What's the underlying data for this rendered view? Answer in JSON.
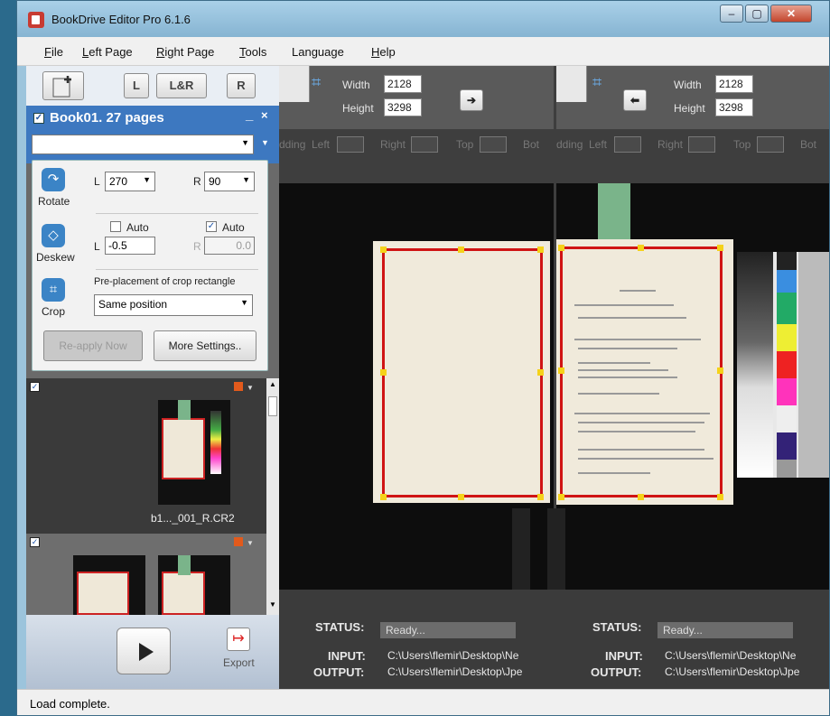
{
  "window": {
    "title": "BookDrive Editor Pro 6.1.6"
  },
  "menu": [
    "File",
    "Left Page",
    "Right Page",
    "Tools",
    "Language",
    "Help"
  ],
  "menu_underline": [
    "F",
    "L",
    "R",
    "T",
    "",
    "H"
  ],
  "toolbar": {
    "l": "L",
    "lr": "L&R",
    "r": "R"
  },
  "book": {
    "header": "Book01. 27 pages",
    "min": "_",
    "close": "×"
  },
  "rotate": {
    "label": "Rotate",
    "l_label": "L",
    "l_value": "270",
    "r_label": "R",
    "r_value": "90"
  },
  "deskew": {
    "label": "Deskew",
    "auto_left": "Auto",
    "auto_right": "Auto",
    "l_label": "L",
    "l_value": "-0.5",
    "r_label": "R",
    "r_value": "0.0"
  },
  "crop": {
    "label": "Crop",
    "prelabel": "Pre-placement of crop rectangle",
    "mode": "Same position"
  },
  "actions": {
    "reapply": "Re-apply Now",
    "more": "More Settings.."
  },
  "thumbs": [
    {
      "name": "b1..._001_R.CR2"
    }
  ],
  "export": "Export",
  "status_bar": "Load complete.",
  "left_view": {
    "width_label": "Width",
    "width": "2128",
    "height_label": "Height",
    "height": "3298",
    "pad": [
      "dding",
      "Left",
      "Right",
      "Top",
      "Bot"
    ]
  },
  "right_view": {
    "width_label": "Width",
    "width": "2128",
    "height_label": "Height",
    "height": "3298",
    "pad": [
      "dding",
      "Left",
      "Right",
      "Top",
      "Bot"
    ]
  },
  "status": {
    "label": "STATUS:",
    "value": "Ready...",
    "input_label": "INPUT:",
    "input": "C:\\Users\\flemir\\Desktop\\Ne",
    "output_label": "OUTPUT:",
    "output": "C:\\Users\\flemir\\Desktop\\Jpe"
  },
  "colors": {
    "accent": "#3d78c0",
    "crop": "#d01414",
    "handle": "#f5d21a"
  }
}
